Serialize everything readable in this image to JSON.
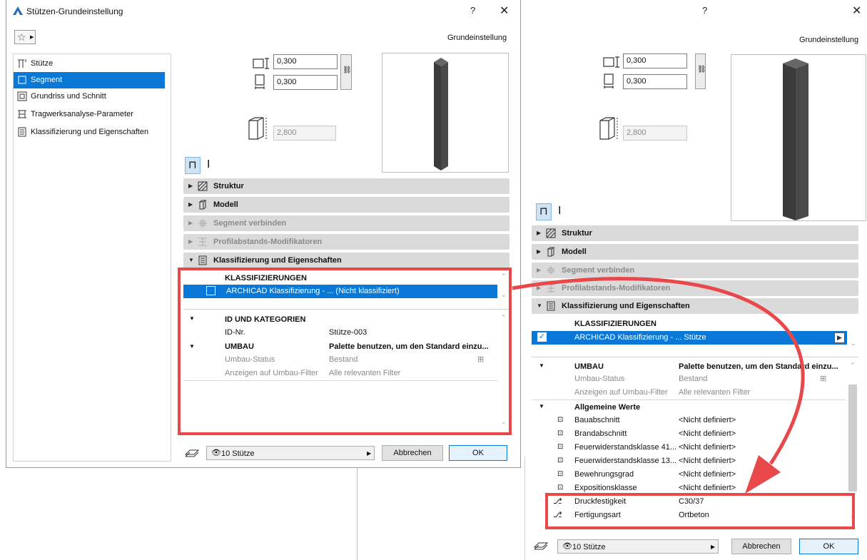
{
  "left_dialog": {
    "title": "Stützen-Grundeinstellung",
    "help": "?",
    "close": "✕",
    "header_label": "Grundeinstellung",
    "nav": [
      {
        "label": "Stütze",
        "icon": "column-icon"
      },
      {
        "label": "Segment",
        "icon": "segment-icon"
      },
      {
        "label": "Grundriss und Schnitt",
        "icon": "floorplan-icon"
      },
      {
        "label": "Tragwerksanalyse-Parameter",
        "icon": "structural-analysis-icon"
      },
      {
        "label": "Klassifizierung und Eigenschaften",
        "icon": "classification-icon"
      }
    ],
    "width_value": "0,300",
    "depth_value": "0,300",
    "height_value": "2,800",
    "panels": [
      {
        "label": "Struktur",
        "icon": "hatch-icon",
        "arrow": "▶"
      },
      {
        "label": "Modell",
        "icon": "model-icon",
        "arrow": "▶"
      },
      {
        "label": "Segment verbinden",
        "icon": "connect-icon",
        "arrow": "▶"
      },
      {
        "label": "Profilabstands-Modifikatoren",
        "icon": "profile-modifier-icon",
        "arrow": "▶"
      },
      {
        "label": "Klassifizierung und Eigenschaften",
        "icon": "classification-icon",
        "arrow": "▼"
      }
    ],
    "classifications_header": "KLASSIFIZIERUNGEN",
    "classification_row": "ARCHICAD Klassifizierung - ... (Nicht klassifiziert)",
    "id_header": "ID UND KATEGORIEN",
    "id_label": "ID-Nr.",
    "id_value": "Stütze-003",
    "umbau_header": "UMBAU",
    "umbau_value": "Palette benutzen, um den Standard einzu...",
    "umbau_status_label": "Umbau-Status",
    "umbau_status_value": "Bestand",
    "umbau_filter_label": "Anzeigen auf Umbau-Filter",
    "umbau_filter_value": "Alle relevanten Filter",
    "layer_label": "10 Stütze",
    "cancel_label": "Abbrechen",
    "ok_label": "OK"
  },
  "right_dialog": {
    "help": "?",
    "close": "✕",
    "header_label": "Grundeinstellung",
    "width_value": "0,300",
    "depth_value": "0,300",
    "height_value": "2,800",
    "panels": [
      {
        "label": "Struktur",
        "icon": "hatch-icon",
        "arrow": "▶"
      },
      {
        "label": "Modell",
        "icon": "model-icon",
        "arrow": "▶"
      },
      {
        "label": "Segment verbinden",
        "icon": "connect-icon",
        "arrow": "▶"
      },
      {
        "label": "Profilabstands-Modifikatoren",
        "icon": "profile-modifier-icon",
        "arrow": "▶"
      },
      {
        "label": "Klassifizierung und Eigenschaften",
        "icon": "classification-icon",
        "arrow": "▼"
      }
    ],
    "classifications_header": "KLASSIFIZIERUNGEN",
    "classification_row": "ARCHICAD Klassifizierung - ... Stütze",
    "umbau_header": "UMBAU",
    "umbau_value": "Palette benutzen, um den Standard einzu...",
    "umbau_status_label": "Umbau-Status",
    "umbau_status_value": "Bestand",
    "umbau_filter_label": "Anzeigen auf Umbau-Filter",
    "umbau_filter_value": "Alle relevanten Filter",
    "general_header": "Allgemeine Werte",
    "properties": [
      {
        "label": "Bauabschnitt",
        "value": "<Nicht definiert>"
      },
      {
        "label": "Brandabschnitt",
        "value": "<Nicht definiert>"
      },
      {
        "label": "Feuerwiderstandsklasse 41...",
        "value": "<Nicht definiert>"
      },
      {
        "label": "Feuerwiderstandsklasse 13...",
        "value": "<Nicht definiert>"
      },
      {
        "label": "Bewehrungsgrad",
        "value": "<Nicht definiert>"
      },
      {
        "label": "Expositionsklasse",
        "value": "<Nicht definiert>"
      }
    ],
    "highlighted_properties": [
      {
        "label": "Druckfestigkeit",
        "value": "C30/37"
      },
      {
        "label": "Fertigungsart",
        "value": "Ortbeton"
      }
    ],
    "layer_label": "10 Stütze",
    "cancel_label": "Abbrechen",
    "ok_label": "OK"
  },
  "colors": {
    "accent": "#0a78d7",
    "annotation_red": "#e8484a",
    "panel_bar": "#dadada"
  }
}
